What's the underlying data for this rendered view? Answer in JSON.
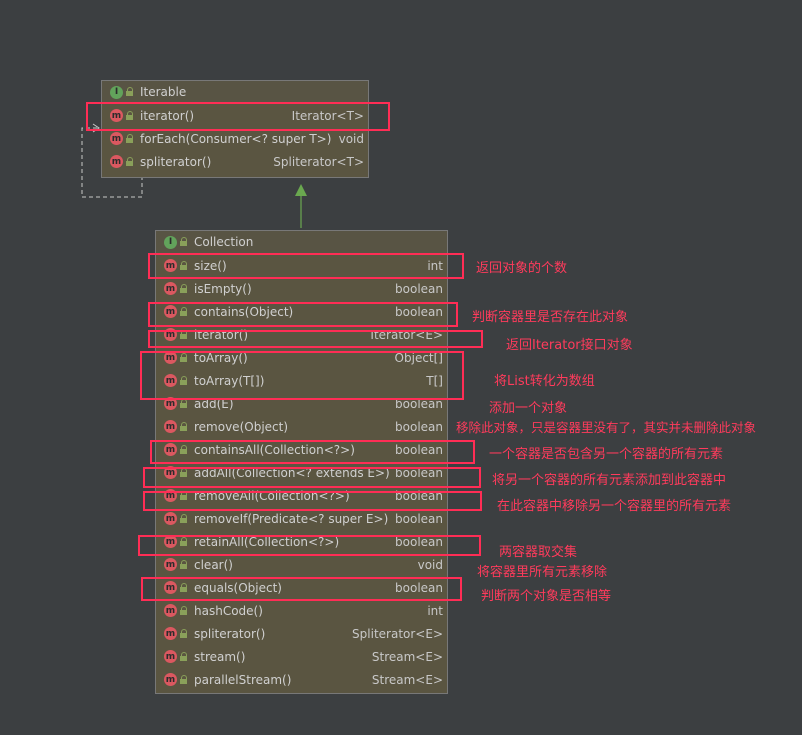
{
  "iterable": {
    "title": "Iterable",
    "methods": [
      {
        "name": "iterator()",
        "type": "Iterator<T>"
      },
      {
        "name": "forEach(Consumer<? super T>)",
        "type": "void"
      },
      {
        "name": "spliterator()",
        "type": "Spliterator<T>"
      }
    ]
  },
  "collection": {
    "title": "Collection",
    "methods": [
      {
        "name": "size()",
        "type": "int"
      },
      {
        "name": "isEmpty()",
        "type": "boolean"
      },
      {
        "name": "contains(Object)",
        "type": "boolean"
      },
      {
        "name": "iterator()",
        "type": "Iterator<E>"
      },
      {
        "name": "toArray()",
        "type": "Object[]"
      },
      {
        "name": "toArray(T[])",
        "type": "T[]"
      },
      {
        "name": "add(E)",
        "type": "boolean"
      },
      {
        "name": "remove(Object)",
        "type": "boolean"
      },
      {
        "name": "containsAll(Collection<?>)",
        "type": "boolean"
      },
      {
        "name": "addAll(Collection<? extends E>)",
        "type": "boolean"
      },
      {
        "name": "removeAll(Collection<?>)",
        "type": "boolean"
      },
      {
        "name": "removeIf(Predicate<? super E>)",
        "type": "boolean"
      },
      {
        "name": "retainAll(Collection<?>)",
        "type": "boolean"
      },
      {
        "name": "clear()",
        "type": "void"
      },
      {
        "name": "equals(Object)",
        "type": "boolean"
      },
      {
        "name": "hashCode()",
        "type": "int"
      },
      {
        "name": "spliterator()",
        "type": "Spliterator<E>"
      },
      {
        "name": "stream()",
        "type": "Stream<E>"
      },
      {
        "name": "parallelStream()",
        "type": "Stream<E>"
      }
    ]
  },
  "icons": {
    "interface": "I",
    "method": "m"
  },
  "notes": {
    "size": "返回对象的个数",
    "contains": "判断容器里是否存在此对象",
    "iterator": "返回Iterator接口对象",
    "toArray": "将List转化为数组",
    "add": "添加一个对象",
    "remove": "移除此对象，只是容器里没有了，其实并未删除此对象",
    "containsAll": "一个容器是否包含另一个容器的所有元素",
    "addAll": "将另一个容器的所有元素添加到此容器中",
    "removeAll": "在此容器中移除另一个容器里的所有元素",
    "retainAll": "两容器取交集",
    "clear": "将容器里所有元素移除",
    "equals": "判断两个对象是否相等"
  },
  "colors": {
    "background": "#3c3f41",
    "box": "#5a5541",
    "highlight": "#ff2d55",
    "interface_icon": "#62a35b",
    "method_icon": "#db5860"
  }
}
